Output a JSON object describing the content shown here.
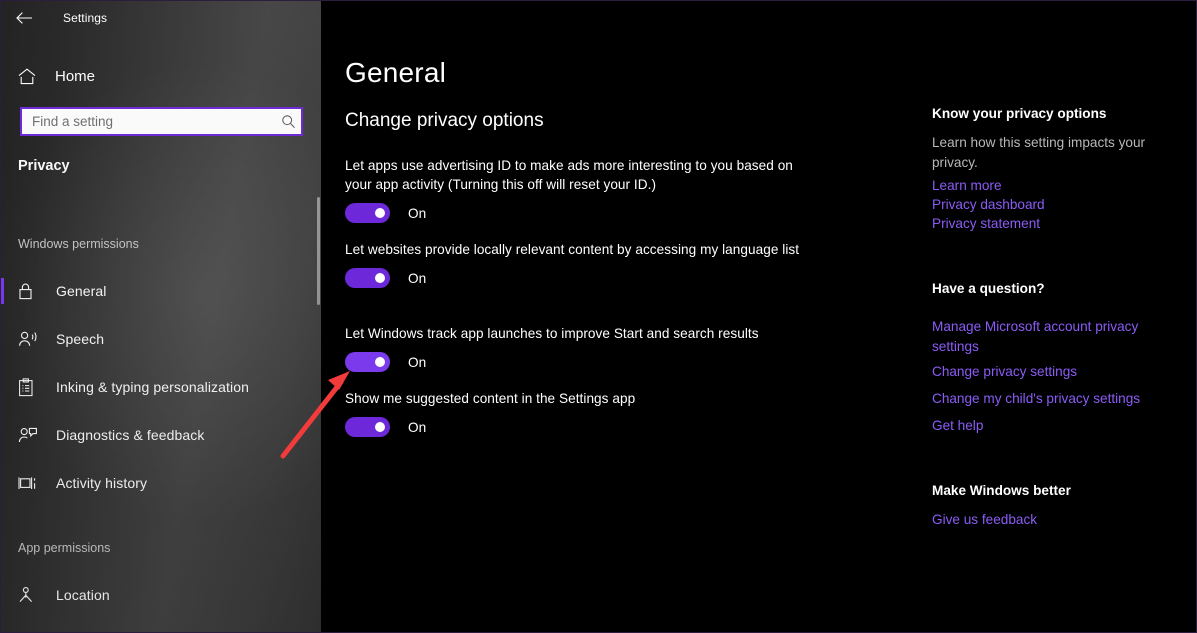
{
  "window": {
    "app_title": "Settings",
    "back_icon": "back-arrow-icon",
    "controls": {
      "minimize": "minimize-icon",
      "maximize": "maximize-icon",
      "close": "close-icon"
    }
  },
  "sidebar": {
    "home": {
      "label": "Home",
      "icon": "home-icon"
    },
    "search": {
      "placeholder": "Find a setting",
      "value": "",
      "icon": "search-icon"
    },
    "category": "Privacy",
    "groups": [
      {
        "label": "Windows permissions",
        "items": [
          {
            "label": "General",
            "icon": "lock-icon",
            "selected": true
          },
          {
            "label": "Speech",
            "icon": "speech-person-icon",
            "selected": false
          },
          {
            "label": "Inking & typing personalization",
            "icon": "clipboard-icon",
            "selected": false
          },
          {
            "label": "Diagnostics & feedback",
            "icon": "person-feedback-icon",
            "selected": false
          },
          {
            "label": "Activity history",
            "icon": "activity-timeline-icon",
            "selected": false
          }
        ]
      },
      {
        "label": "App permissions",
        "items": [
          {
            "label": "Location",
            "icon": "location-pin-icon",
            "selected": false
          }
        ]
      }
    ]
  },
  "main": {
    "page_title": "General",
    "section_title": "Change privacy options",
    "options": [
      {
        "text": "Let apps use advertising ID to make ads more interesting to you based on your app activity (Turning this off will reset your ID.)",
        "state": "On",
        "on": true,
        "hovered": false
      },
      {
        "text": "Let websites provide locally relevant content by accessing my language list",
        "state": "On",
        "on": true,
        "hovered": false
      },
      {
        "text": "Let Windows track app launches to improve Start and search results",
        "state": "On",
        "on": true,
        "hovered": true
      },
      {
        "text": "Show me suggested content in the Settings app",
        "state": "On",
        "on": true,
        "hovered": false
      }
    ]
  },
  "rail": {
    "section1": {
      "heading": "Know your privacy options",
      "description": "Learn how this setting impacts your privacy.",
      "links": [
        "Learn more",
        "Privacy dashboard",
        "Privacy statement"
      ]
    },
    "section2": {
      "heading": "Have a question?",
      "links": [
        "Manage Microsoft account privacy settings",
        "Change privacy settings",
        "Change my child's privacy settings",
        "Get help"
      ]
    },
    "section3": {
      "heading": "Make Windows better",
      "links": [
        "Give us feedback"
      ]
    }
  },
  "annotation": {
    "type": "red-arrow",
    "color": "#f23b3b",
    "points_to": "Let Windows track app launches toggle"
  },
  "colors": {
    "accent": "#6d28d9",
    "accent_hover": "#7c3aed",
    "link": "#8b5cf6",
    "background": "#000000",
    "annotation_red": "#f23b3b"
  }
}
